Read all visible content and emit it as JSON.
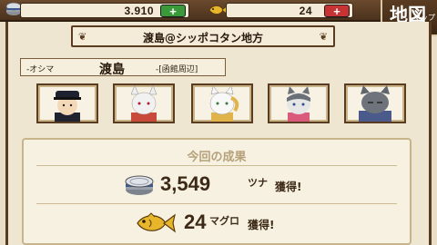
{
  "top_bar": {
    "tuna_count": "3.910",
    "fish_count": "24",
    "plus_label": "+",
    "map_button": {
      "label": "地図",
      "sub_label": "マップ"
    }
  },
  "header": {
    "title": "渡島@シッポコタン地方"
  },
  "island": {
    "prefix": "-オシマ",
    "name": "渡島",
    "area": "-[函館周辺]"
  },
  "characters": [
    {
      "name": "boy-with-cap"
    },
    {
      "name": "white-fox-girl"
    },
    {
      "name": "white-cat-girl"
    },
    {
      "name": "gray-cat-girl"
    },
    {
      "name": "gray-cat-elder"
    }
  ],
  "result": {
    "title": "今回の成果",
    "tuna": {
      "amount": "3,549",
      "unit": "ツナ",
      "label": "獲得!"
    },
    "fish": {
      "amount": "24",
      "unit": "マグロ",
      "label": "獲得!"
    }
  },
  "colors": {
    "bar_brown": "#4b321d",
    "frame_brown": "#5a3c22",
    "plus_green": "#3a9a3a",
    "plus_red": "#c73232",
    "fish_gold": "#e8b62a"
  },
  "icons": [
    "tuna-can-icon",
    "fish-icon",
    "plus-icon"
  ]
}
